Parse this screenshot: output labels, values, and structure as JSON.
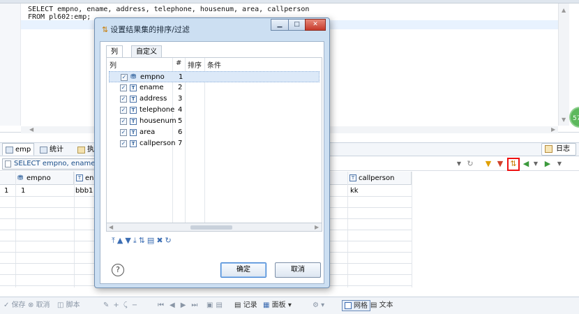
{
  "editor": {
    "line1": "SELECT empno, ename, address, telephone, housenum, area, callperson",
    "line2": "FROM pl602:emp;",
    "badge": "57"
  },
  "result_tabs": [
    {
      "label": "emp"
    },
    {
      "label": "统计"
    },
    {
      "label": "执"
    }
  ],
  "log_button": "日志",
  "sql_preview": "SELECT empno, ename, a",
  "grid": {
    "headers": [
      "empno",
      "en",
      "callperson"
    ],
    "row": {
      "num": "1",
      "empno": "1",
      "ename": "bbb1",
      "callperson": "kk"
    }
  },
  "bottom_bar": {
    "save": "保存",
    "cancel": "取消",
    "script": "脚本",
    "record": "记录",
    "panel": "面板",
    "grid": "网格",
    "text": "文本"
  },
  "dialog": {
    "title": "设置结果集的排序/过滤",
    "tabs": [
      "列",
      "自定义"
    ],
    "headers": {
      "col": "列",
      "num": "#",
      "sort": "排序",
      "condition": "条件"
    },
    "rows": [
      {
        "name": "empno",
        "num": "1"
      },
      {
        "name": "ename",
        "num": "2"
      },
      {
        "name": "address",
        "num": "3"
      },
      {
        "name": "telephone",
        "num": "4"
      },
      {
        "name": "housenum",
        "num": "5"
      },
      {
        "name": "area",
        "num": "6"
      },
      {
        "name": "callperson",
        "num": "7"
      }
    ],
    "help": "?",
    "ok": "确定",
    "cancel": "取消"
  }
}
